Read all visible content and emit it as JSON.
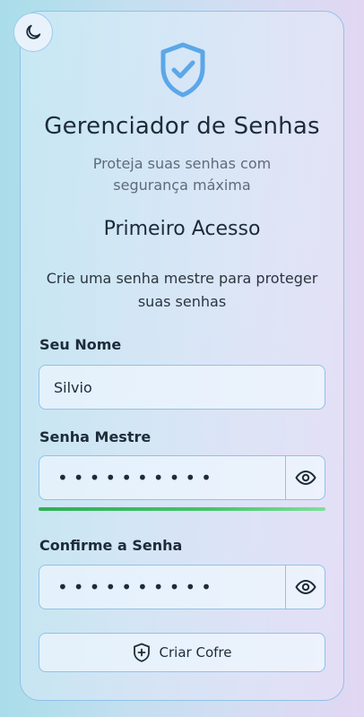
{
  "app": {
    "title": "Gerenciador de Senhas",
    "subtitle": "Proteja suas senhas com segurança máxima"
  },
  "setup": {
    "heading": "Primeiro Acesso",
    "description": "Crie uma senha mestre para proteger suas senhas"
  },
  "form": {
    "name_label": "Seu Nome",
    "name_value": "Silvio",
    "master_label": "Senha Mestre",
    "master_value": "••••••••••",
    "master_strength": 1.0,
    "confirm_label": "Confirme a Senha",
    "confirm_value": "••••••••••",
    "submit_label": "Criar Cofre"
  },
  "icons": {
    "theme": "moon-icon",
    "logo": "shield-check-icon",
    "toggle_visibility": "eye-icon",
    "submit": "shield-plus-icon"
  },
  "colors": {
    "accent": "#5ba7e8",
    "strength": "#3cb95f"
  }
}
